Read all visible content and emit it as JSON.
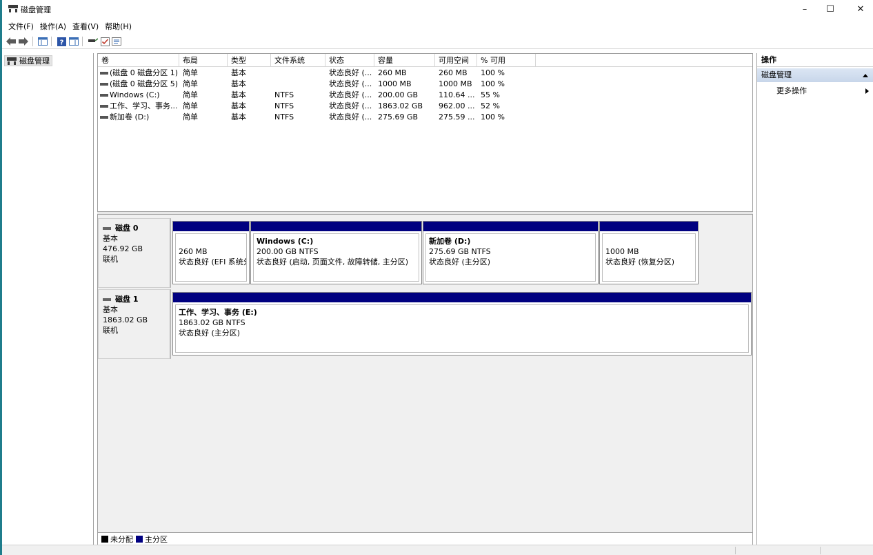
{
  "window": {
    "title": "磁盘管理",
    "minimize": "–",
    "maximize": "☐",
    "close": "✕"
  },
  "menu": [
    "文件(F)",
    "操作(A)",
    "查看(V)",
    "帮助(H)"
  ],
  "tree": {
    "root": "磁盘管理"
  },
  "columns": [
    "卷",
    "布局",
    "类型",
    "文件系统",
    "状态",
    "容量",
    "可用空间",
    "% 可用"
  ],
  "volumes": [
    {
      "name": "(磁盘 0 磁盘分区 1)",
      "layout": "简单",
      "type": "基本",
      "fs": "",
      "status": "状态良好 (...",
      "capacity": "260 MB",
      "free": "260 MB",
      "pct": "100 %"
    },
    {
      "name": "(磁盘 0 磁盘分区 5)",
      "layout": "简单",
      "type": "基本",
      "fs": "",
      "status": "状态良好 (...",
      "capacity": "1000 MB",
      "free": "1000 MB",
      "pct": "100 %"
    },
    {
      "name": "Windows (C:)",
      "layout": "简单",
      "type": "基本",
      "fs": "NTFS",
      "status": "状态良好 (...",
      "capacity": "200.00 GB",
      "free": "110.64 ...",
      "pct": "55 %"
    },
    {
      "name": "工作、学习、事务...",
      "layout": "简单",
      "type": "基本",
      "fs": "NTFS",
      "status": "状态良好 (...",
      "capacity": "1863.02 GB",
      "free": "962.00 ...",
      "pct": "52 %"
    },
    {
      "name": "新加卷 (D:)",
      "layout": "简单",
      "type": "基本",
      "fs": "NTFS",
      "status": "状态良好 (...",
      "capacity": "275.69 GB",
      "free": "275.59 ...",
      "pct": "100 %"
    }
  ],
  "disks": [
    {
      "name": "磁盘 0",
      "kind": "基本",
      "size": "476.92 GB",
      "state": "联机",
      "partitions": [
        {
          "name": "",
          "size": "260 MB",
          "status": "状态良好 (EFI 系统分区)"
        },
        {
          "name": "Windows  (C:)",
          "size": "200.00 GB NTFS",
          "status": "状态良好 (启动, 页面文件, 故障转储, 主分区)"
        },
        {
          "name": "新加卷  (D:)",
          "size": "275.69 GB NTFS",
          "status": "状态良好 (主分区)"
        },
        {
          "name": "",
          "size": "1000 MB",
          "status": "状态良好 (恢复分区)"
        }
      ]
    },
    {
      "name": "磁盘 1",
      "kind": "基本",
      "size": "1863.02 GB",
      "state": "联机",
      "partitions": [
        {
          "name": "工作、学习、事务  (E:)",
          "size": "1863.02 GB NTFS",
          "status": "状态良好 (主分区)"
        }
      ]
    }
  ],
  "legend": [
    {
      "label": "未分配",
      "color": "#000000"
    },
    {
      "label": "主分区",
      "color": "#000080"
    }
  ],
  "actions": {
    "header": "操作",
    "section": "磁盘管理",
    "item": "更多操作"
  },
  "colors": {
    "partition_header": "#000080",
    "accent_strip": "#1f7d8c"
  }
}
